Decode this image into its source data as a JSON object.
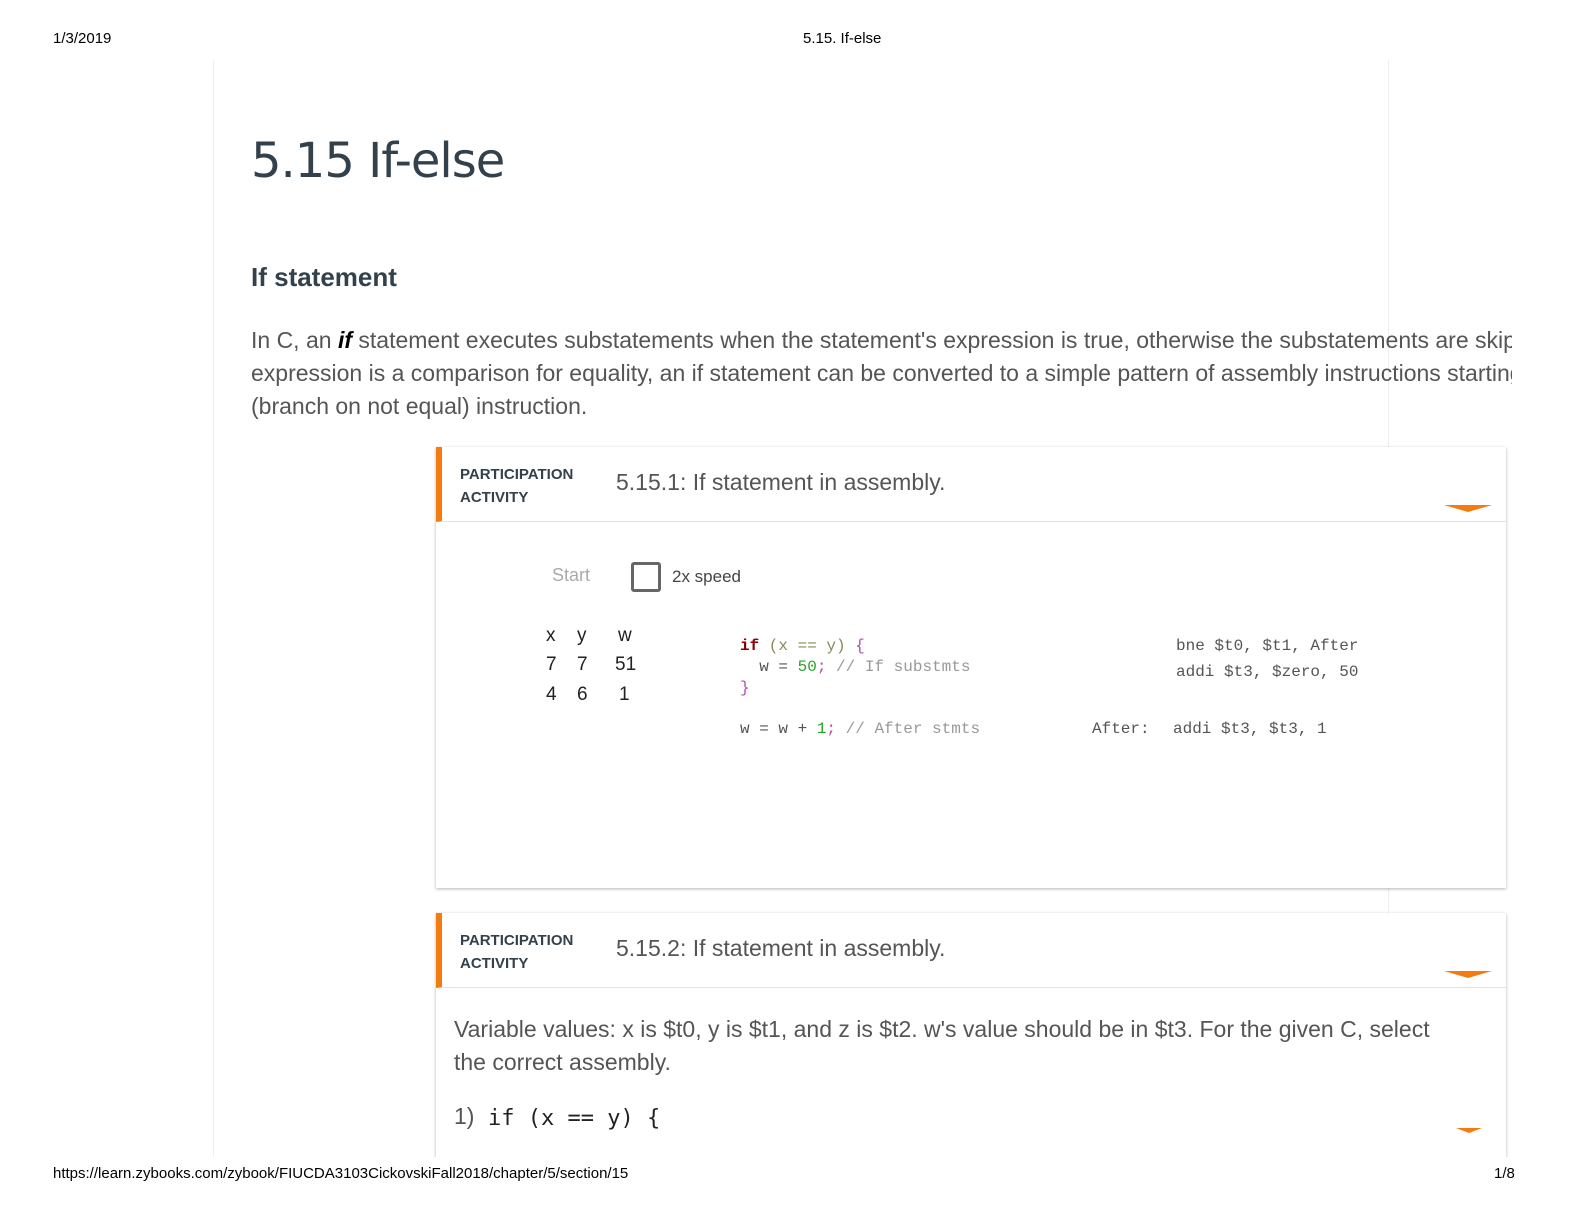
{
  "print_header": {
    "date": "1/3/2019",
    "title": "5.15. If-else"
  },
  "print_footer": {
    "url": "https://learn.zybooks.com/zybook/FIUCDA3103CickovskiFall2018/chapter/5/section/15",
    "page": "1/8"
  },
  "page_title": "5.15 If-else",
  "section_heading": "If statement",
  "paragraph": {
    "l1_pre": "In C, an ",
    "l1_kw": "if",
    "l1_post": " statement executes substatements when the statement's expression is true, otherwise the substatements are skipped. When the",
    "l2": "expression is a comparison for equality, an if statement can be converted to a simple pattern of assembly instructions starting with a bne",
    "l3": "(branch on not equal) instruction."
  },
  "activity1": {
    "label_line1": "PARTICIPATION",
    "label_line2": "ACTIVITY",
    "title": "5.15.1: If statement in assembly.",
    "start_label": "Start",
    "speed_label": "2x speed",
    "speed_checked": false,
    "table": {
      "headers": [
        "x",
        "y",
        "w"
      ],
      "rows": [
        [
          "7",
          "7",
          "51"
        ],
        [
          "4",
          "6",
          "1"
        ]
      ]
    },
    "c_code": {
      "if_kw": "if",
      "cond": " (x == y) ",
      "brace_open": "{",
      "body_w": "  w = ",
      "body_val": "50",
      "body_semi": ";",
      "body_comment": " // If substmts",
      "brace_close": "}",
      "after_w": "w = w + ",
      "after_val": "1",
      "after_semi": ";",
      "after_comment": " // After stmts"
    },
    "asm": {
      "line1": "bne $t0, $t1, After",
      "line2": "addi $t3, $zero, 50",
      "line3_label": "After:",
      "line3": "addi $t3, $t3, 1"
    }
  },
  "activity2": {
    "label_line1": "PARTICIPATION",
    "label_line2": "ACTIVITY",
    "title": "5.15.2: If statement in assembly.",
    "instructions": "Variable values: x is $t0, y is $t1, and z is $t2. w's value should be in $t3. For the given C, select the correct assembly.",
    "q1_num": "1)",
    "q1_code": "if (x == y) {"
  },
  "colors": {
    "accent": "#f47c0f",
    "keyword": "#8b0000",
    "number": "#2aa12a",
    "brace": "#b04fb0"
  }
}
